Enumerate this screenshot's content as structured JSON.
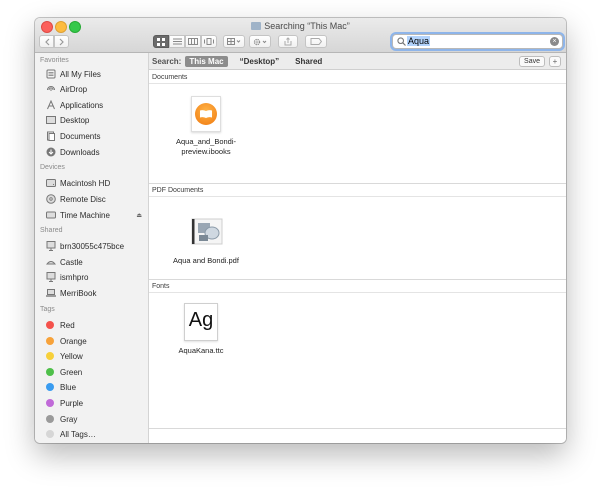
{
  "window": {
    "title": "Searching “This Mac”"
  },
  "search": {
    "query": "Aqua"
  },
  "scope": {
    "label": "Search:",
    "options": [
      "This Mac",
      "“Desktop”",
      "Shared"
    ],
    "active": "This Mac",
    "save_label": "Save",
    "add_label": "+"
  },
  "sidebar": {
    "favorites_header": "Favorites",
    "favorites": [
      {
        "label": "All My Files",
        "icon": "all-files-icon"
      },
      {
        "label": "AirDrop",
        "icon": "airdrop-icon"
      },
      {
        "label": "Applications",
        "icon": "applications-icon"
      },
      {
        "label": "Desktop",
        "icon": "desktop-icon"
      },
      {
        "label": "Documents",
        "icon": "documents-icon"
      },
      {
        "label": "Downloads",
        "icon": "downloads-icon"
      }
    ],
    "devices_header": "Devices",
    "devices": [
      {
        "label": "Macintosh HD",
        "icon": "hard-disk-icon"
      },
      {
        "label": "Remote Disc",
        "icon": "disc-icon"
      },
      {
        "label": "Time Machine",
        "icon": "drive-icon",
        "eject": "⏏"
      }
    ],
    "shared_header": "Shared",
    "shared": [
      {
        "label": "brn30055c475bce",
        "icon": "computer-icon"
      },
      {
        "label": "Castle",
        "icon": "airport-icon"
      },
      {
        "label": "ismhpro",
        "icon": "computer-icon"
      },
      {
        "label": "MerriBook",
        "icon": "laptop-icon"
      }
    ],
    "tags_header": "Tags",
    "tags": [
      {
        "label": "Red",
        "color": "#f4524c"
      },
      {
        "label": "Orange",
        "color": "#f7a23a"
      },
      {
        "label": "Yellow",
        "color": "#f7d03a"
      },
      {
        "label": "Green",
        "color": "#4fc04a"
      },
      {
        "label": "Blue",
        "color": "#3a9cf0"
      },
      {
        "label": "Purple",
        "color": "#c06ad8"
      },
      {
        "label": "Gray",
        "color": "#9a9a9a"
      },
      {
        "label": "All Tags…",
        "color": "#d6d6d6"
      }
    ]
  },
  "results": {
    "sections": [
      {
        "header": "Documents",
        "files": [
          {
            "name_line1": "Aqua_and_Bondi-",
            "name_line2": "preview.ibooks",
            "icon": "ibooks-icon"
          }
        ]
      },
      {
        "header": "PDF Documents",
        "files": [
          {
            "name_line1": "Aqua and Bondi.pdf",
            "icon": "pdf-icon"
          }
        ]
      },
      {
        "header": "Fonts",
        "files": [
          {
            "name_line1": "AquaKana.ttc",
            "icon": "font-icon",
            "glyph": "Ag"
          }
        ]
      }
    ]
  }
}
